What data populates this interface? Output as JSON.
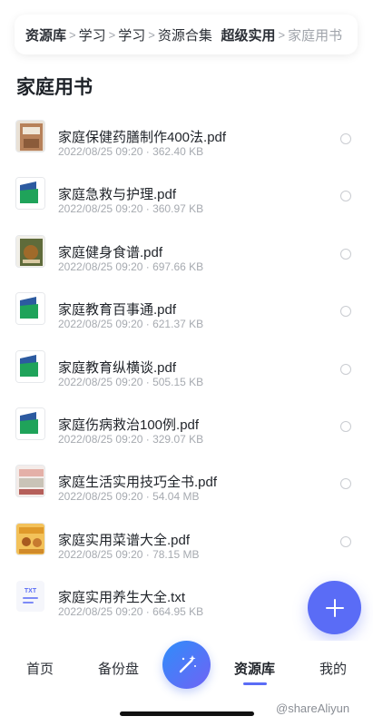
{
  "breadcrumb": {
    "items": [
      "资源库",
      "学习",
      "学习",
      "资源合集",
      "超级实用",
      "家庭用书"
    ],
    "separator": ">"
  },
  "page": {
    "title": "家庭用书"
  },
  "files": [
    {
      "name": "家庭保健药膳制作400法.pdf",
      "meta": "2022/08/25 09:20 · 362.40 KB",
      "thumb": "book-cover-brown-icon"
    },
    {
      "name": "家庭急救与护理.pdf",
      "meta": "2022/08/25 09:20 · 360.97 KB",
      "thumb": "pdf-icon"
    },
    {
      "name": "家庭健身食谱.pdf",
      "meta": "2022/08/25 09:20 · 697.66 KB",
      "thumb": "book-cover-green-icon"
    },
    {
      "name": "家庭教育百事通.pdf",
      "meta": "2022/08/25 09:20 · 621.37 KB",
      "thumb": "pdf-icon"
    },
    {
      "name": "家庭教育纵横谈.pdf",
      "meta": "2022/08/25 09:20 · 505.15 KB",
      "thumb": "pdf-icon"
    },
    {
      "name": "家庭伤病救治100例.pdf",
      "meta": "2022/08/25 09:20 · 329.07 KB",
      "thumb": "pdf-icon"
    },
    {
      "name": "家庭生活实用技巧全书.pdf",
      "meta": "2022/08/25 09:20 · 54.04 MB",
      "thumb": "book-cover-pink-icon"
    },
    {
      "name": "家庭实用菜谱大全.pdf",
      "meta": "2022/08/25 09:20 · 78.15 MB",
      "thumb": "book-cover-orange-icon"
    },
    {
      "name": "家庭实用养生大全.txt",
      "meta": "2022/08/25 09:20 · 664.95 KB",
      "thumb": "txt-icon"
    }
  ],
  "fab": {
    "icon": "plus-icon"
  },
  "tabbar": {
    "tabs": [
      {
        "label": "首页"
      },
      {
        "label": "备份盘"
      },
      {
        "label": "资源库"
      },
      {
        "label": "我的"
      }
    ],
    "active": "资源库",
    "center_icon": "magic-wand-icon"
  },
  "watermark": "@shareAliyun",
  "colors": {
    "accent": "#5a6cf6",
    "text": "#1f2329",
    "muted": "#a6aab0"
  }
}
